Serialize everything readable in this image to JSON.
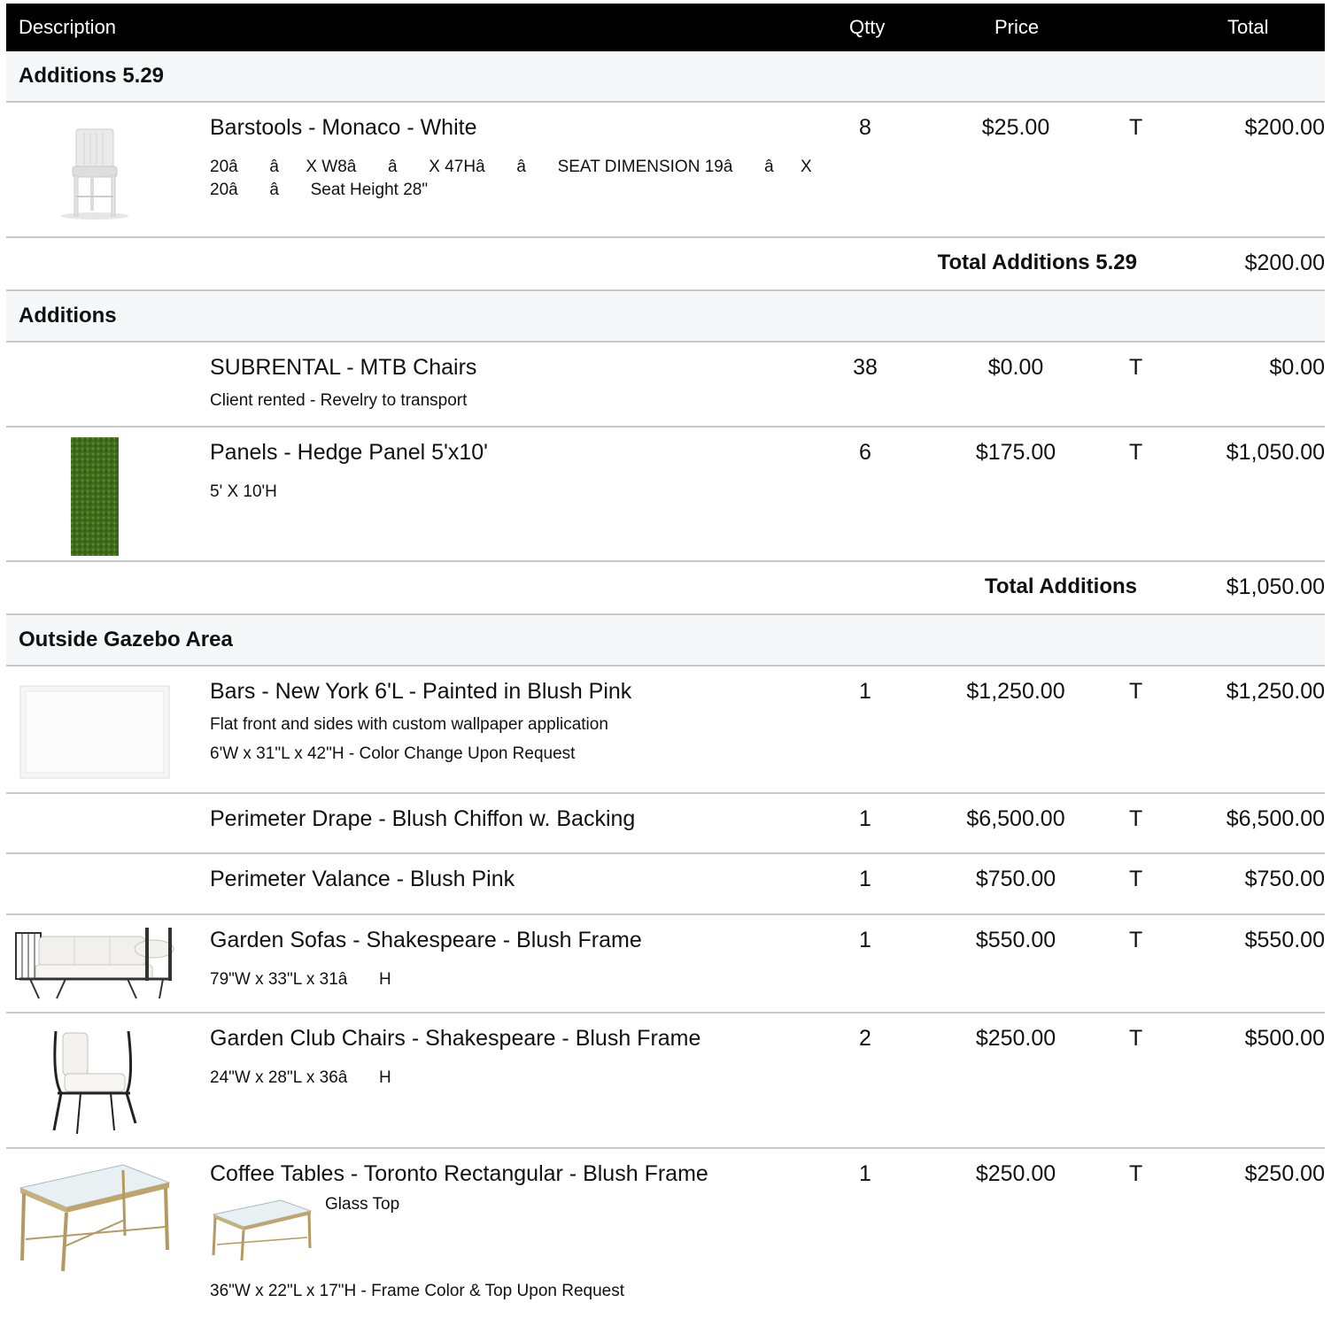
{
  "header": {
    "description": "Description",
    "qty": "Qtty",
    "price": "Price",
    "total": "Total"
  },
  "sections": [
    {
      "name": "Additions 5.29",
      "items": [
        {
          "title": "Barstools - Monaco - White",
          "desc1": "20â âX W8â â X 47Hâ â SEAT DIMENSION 19â âX",
          "desc2": "20â â Seat Height 28\"",
          "qty": "8",
          "price": "$25.00",
          "tax": "T",
          "total": "$200.00"
        }
      ],
      "subtotal_label": "Total Additions 5.29",
      "subtotal_value": "$200.00"
    },
    {
      "name": "Additions",
      "items": [
        {
          "title": "SUBRENTAL - MTB Chairs",
          "desc1": "Client rented - Revelry to transport",
          "qty": "38",
          "price": "$0.00",
          "tax": "T",
          "total": "$0.00"
        },
        {
          "title": "Panels - Hedge Panel 5'x10'",
          "desc1": "5' X 10'H",
          "qty": "6",
          "price": "$175.00",
          "tax": "T",
          "total": "$1,050.00"
        }
      ],
      "subtotal_label": "Total Additions",
      "subtotal_value": "$1,050.00"
    },
    {
      "name": "Outside Gazebo Area",
      "items": [
        {
          "title": "Bars - New York 6'L - Painted in Blush Pink",
          "desc1": "Flat front and sides with custom wallpaper application",
          "desc2": "6'W x 31\"L x  42\"H - Color Change Upon Request",
          "qty": "1",
          "price": "$1,250.00",
          "tax": "T",
          "total": "$1,250.00"
        },
        {
          "title": "Perimeter Drape - Blush Chiffon w. Backing",
          "qty": "1",
          "price": "$6,500.00",
          "tax": "T",
          "total": "$6,500.00"
        },
        {
          "title": "Perimeter Valance - Blush Pink",
          "qty": "1",
          "price": "$750.00",
          "tax": "T",
          "total": "$750.00"
        },
        {
          "title": "Garden Sofas - Shakespeare - Blush Frame",
          "desc1": "79\"W x 33\"L x 31â H",
          "qty": "1",
          "price": "$550.00",
          "tax": "T",
          "total": "$550.00"
        },
        {
          "title": "Garden Club Chairs - Shakespeare - Blush Frame",
          "desc1": "24\"W x 28\"L x 36â H",
          "qty": "2",
          "price": "$250.00",
          "tax": "T",
          "total": "$500.00"
        },
        {
          "title": "Coffee Tables - Toronto Rectangular - Blush Frame",
          "inline_label": "Glass Top",
          "desc1": "36\"W x 22\"L x 17\"H - Frame Color & Top Upon Request",
          "qty": "1",
          "price": "$250.00",
          "tax": "T",
          "total": "$250.00"
        }
      ]
    }
  ]
}
